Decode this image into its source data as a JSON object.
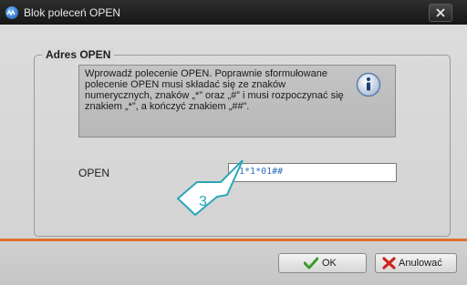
{
  "window": {
    "title": "Blok poleceń OPEN",
    "close_icon": "close-icon"
  },
  "group": {
    "legend": "Adres OPEN"
  },
  "info": {
    "text": "Wprowadź polecenie OPEN. Poprawnie sformułowane\npolecenie OPEN musi składać się ze znaków\nnumerycznych, znaków „*” oraz „#” i musi rozpoczynać się\nznakiem „*”, a kończyć znakiem „##”.",
    "icon": "info-icon"
  },
  "open_field": {
    "label": "OPEN",
    "value": "*1*1*01##"
  },
  "callout": {
    "number": "3"
  },
  "buttons": {
    "ok": "OK",
    "cancel": "Anulować"
  },
  "colors": {
    "accent_orange": "#e0702d",
    "callout_teal": "#2aa7b8",
    "titlebar": "#1e1e1e"
  }
}
